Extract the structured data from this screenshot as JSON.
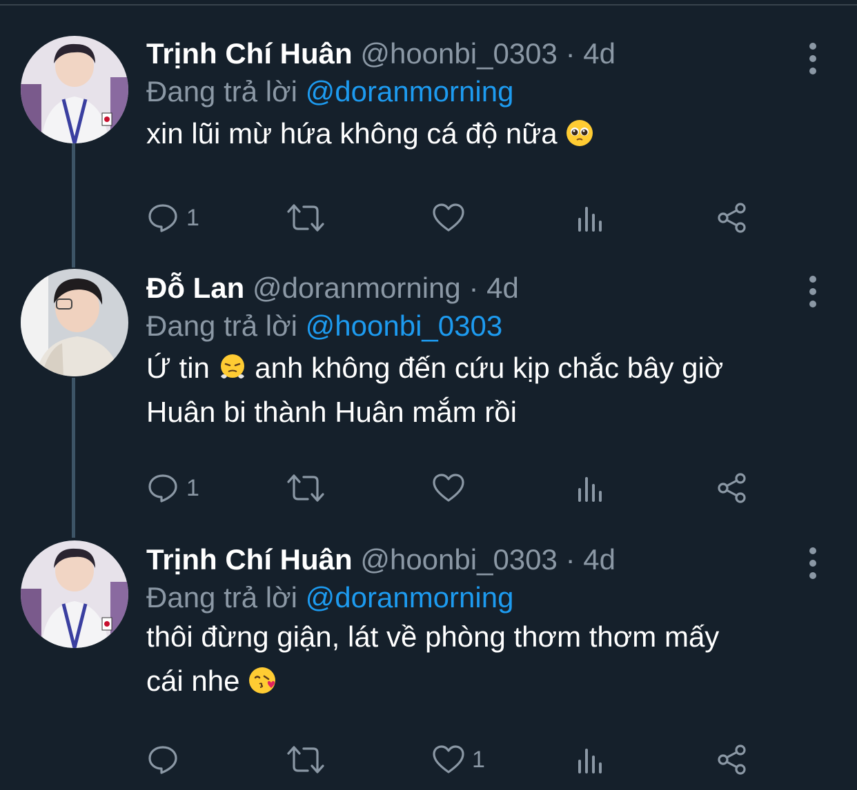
{
  "tweets": [
    {
      "name": "Trịnh Chí Huân",
      "handle": "@hoonbi_0303",
      "dot": "·",
      "time": "4d",
      "reply_prefix": "Đang trả lời",
      "reply_to": "@doranmorning",
      "body_parts": [
        "xin lũi mừ hứa không cá độ nữa ",
        "pleading-face-emoji"
      ],
      "text1": "xin lũi mừ hứa không cá độ nữa",
      "emoji": "pleading-face-emoji",
      "replies": "1",
      "likes": ""
    },
    {
      "name": "Đỗ Lan",
      "handle": "@doranmorning",
      "dot": "·",
      "time": "4d",
      "reply_prefix": "Đang trả lời",
      "reply_to": "@hoonbi_0303",
      "text1": "Ứ tin",
      "emoji": "face-with-steam-emoji",
      "text2": "anh không đến cứu kịp chắc bây giờ",
      "text3": "Huân bi thành Huân mắm rồi",
      "replies": "1",
      "likes": ""
    },
    {
      "name": "Trịnh Chí Huân",
      "handle": "@hoonbi_0303",
      "dot": "·",
      "time": "4d",
      "reply_prefix": "Đang trả lời",
      "reply_to": "@doranmorning",
      "text1": "thôi đừng giận, lát về phòng thơm thơm mấy",
      "text2": "cái nhe",
      "emoji": "face-blowing-kiss-emoji",
      "replies": "",
      "likes": "1"
    }
  ],
  "icons": {
    "reply": "reply-icon",
    "retweet": "retweet-icon",
    "like": "heart-icon",
    "views": "views-icon",
    "share": "share-icon",
    "more": "more-icon"
  },
  "colors": {
    "background": "#15202b",
    "secondary_text": "#8b98a5",
    "mention": "#1d9bf0",
    "thread_line": "#3d5466"
  }
}
